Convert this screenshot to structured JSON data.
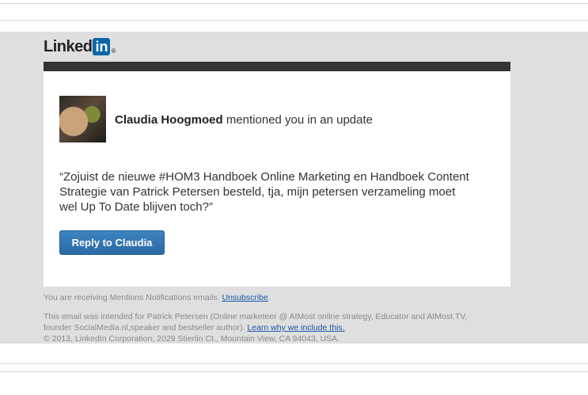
{
  "logo": {
    "text": "Linked",
    "in": "in",
    "reg": "®"
  },
  "update": {
    "sender_name": "Claudia Hoogmoed",
    "action_text": " mentioned you in an update",
    "quote": "“Zojuist de nieuwe #HOM3 Handboek Online Marketing en Handboek Content Strategie van Patrick Petersen besteld, tja, mijn petersen verzameling moet wel Up To Date blijven toch?”",
    "reply_label": "Reply to Claudia"
  },
  "footer": {
    "receiving_text": "You are receiving Mentions Notifications emails. ",
    "unsubscribe_label": "Unsubscribe",
    "receiving_end": ".",
    "intended_text": "This email was intended for Patrick Petersen (Online marketeer @ AtMost online strategy, Educator and AtMost.TV, founder SocialMedia.nl,speaker and bestseller author). ",
    "learn_label": "Learn why we include this.",
    "copyright": "© 2013, LinkedIn Corporation, 2029 Stierlin Ct., Mountain View, CA 94043, USA."
  },
  "colors": {
    "brand_blue": "#0a66a8",
    "button_blue": "#2a6aa6",
    "header_bar": "#333333",
    "background_band": "#dfdfdf"
  }
}
